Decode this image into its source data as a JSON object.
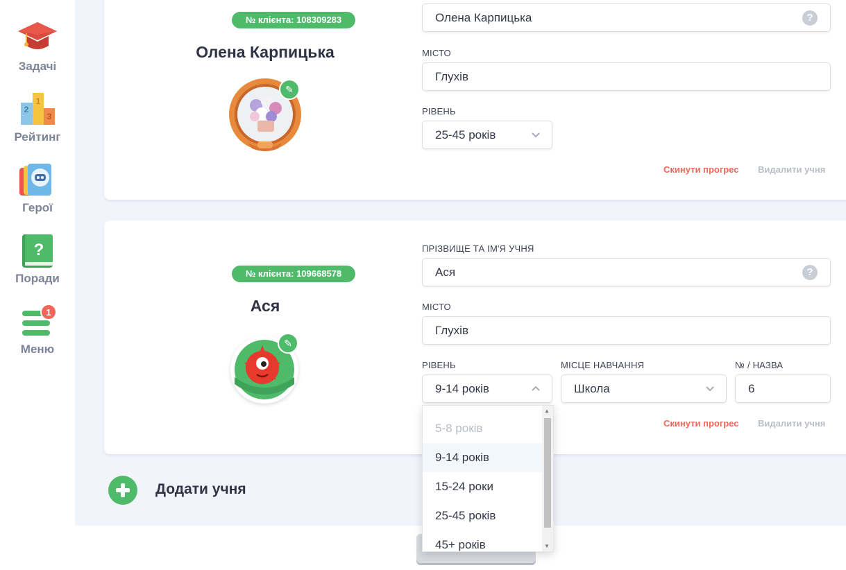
{
  "sidebar": {
    "items": [
      {
        "label": "Задачі",
        "icon": "graduation-cap-icon"
      },
      {
        "label": "Рейтинг",
        "icon": "podium-icon",
        "podium": [
          "2",
          "1",
          "3"
        ]
      },
      {
        "label": "Герої",
        "icon": "heroes-cards-icon"
      },
      {
        "label": "Поради",
        "icon": "question-book-icon",
        "glyph": "?"
      },
      {
        "label": "Меню",
        "icon": "hamburger-menu-icon",
        "badge": "1"
      }
    ]
  },
  "students": [
    {
      "client_badge": "№ клієнта: 108309283",
      "name": "Олена Карпицька",
      "avatar": "flower-bouquet-avatar",
      "fields": {
        "name_value": "Олена Карпицька",
        "city_label": "МІСТО",
        "city_value": "Глухів",
        "level_label": "РІВЕНЬ",
        "level_value": "25-45 років"
      },
      "reset_label": "Скинути прогрес",
      "delete_label": "Видалити учня"
    },
    {
      "client_badge": "№ клієнта: 109668578",
      "name": "Ася",
      "avatar": "red-monster-avatar",
      "fields": {
        "name_label": "ПРІЗВИЩЕ ТА ІМ'Я УЧНЯ",
        "name_value": "Ася",
        "city_label": "МІСТО",
        "city_value": "Глухів",
        "level_label": "РІВЕНЬ",
        "level_value": "9-14 років",
        "study_place_label": "МІСЦЕ НАВЧАННЯ",
        "study_place_value": "Школа",
        "class_label": "№ / НАЗВА",
        "class_value": "6"
      },
      "reset_label": "Скинути прогрес",
      "delete_label": "Видалити учня"
    }
  ],
  "help_glyph": "?",
  "edit_glyph": "✎",
  "add_student_label": "Додати учня",
  "level_dropdown": {
    "options": [
      "5-8 років",
      "9-14 років",
      "15-24 роки",
      "25-45 років",
      "45+ років"
    ],
    "disabled": "5-8 років",
    "selected": "9-14 років"
  },
  "colors": {
    "accent_green": "#4fba6a",
    "reset_red": "#f0675a",
    "background": "#f1f5fb"
  }
}
